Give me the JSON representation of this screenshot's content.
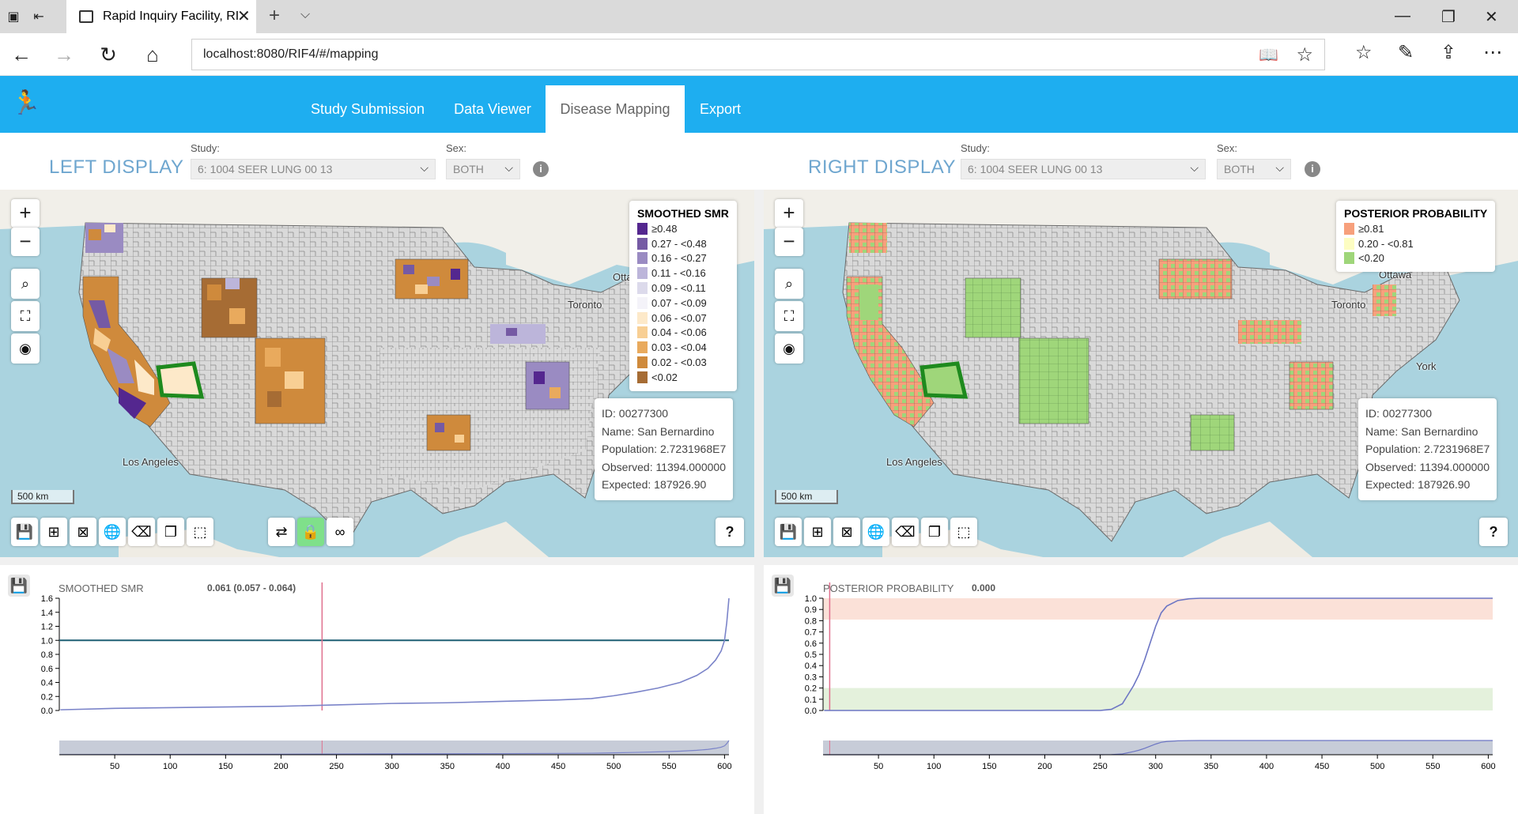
{
  "browser": {
    "tab_title": "Rapid Inquiry Facility, RI",
    "url": "localhost:8080/RIF4/#/mapping"
  },
  "app": {
    "nav": [
      "Study Submission",
      "Data Viewer",
      "Disease Mapping",
      "Export"
    ],
    "active_tab": "Disease Mapping",
    "accent_color": "#1eaef0"
  },
  "left": {
    "title": "LEFT DISPLAY",
    "study_label": "Study:",
    "study_value": "6: 1004 SEER LUNG 00 13",
    "sex_label": "Sex:",
    "sex_value": "BOTH",
    "legend": {
      "title": "SMOOTHED SMR",
      "items": [
        {
          "label": "≥0.48",
          "color": "#54278f"
        },
        {
          "label": "0.27 - <0.48",
          "color": "#755aa4"
        },
        {
          "label": "0.16 - <0.27",
          "color": "#9a8bc2"
        },
        {
          "label": "0.11 - <0.16",
          "color": "#bcb5da"
        },
        {
          "label": "0.09 - <0.11",
          "color": "#dcdaeb"
        },
        {
          "label": "0.07 - <0.09",
          "color": "#f4f3f9"
        },
        {
          "label": "0.06 - <0.07",
          "color": "#fde9c9"
        },
        {
          "label": "0.04 - <0.06",
          "color": "#f8cf94"
        },
        {
          "label": "0.03 - <0.04",
          "color": "#e9aa5d"
        },
        {
          "label": "0.02 - <0.03",
          "color": "#cf8a3c"
        },
        {
          "label": "<0.02",
          "color": "#a66c34"
        }
      ]
    },
    "info": {
      "id": "ID: 00277300",
      "name": "Name: San Bernardino",
      "population": "Population: 2.7231968E7",
      "observed": "Observed: 11394.000000",
      "expected": "Expected: 187926.90"
    },
    "scale": "500 km",
    "labels": {
      "toronto": "Toronto",
      "ottawa": "Otta",
      "losangeles": "Los Angeles"
    }
  },
  "right": {
    "title": "RIGHT DISPLAY",
    "study_label": "Study:",
    "study_value": "6: 1004 SEER LUNG 00 13",
    "sex_label": "Sex:",
    "sex_value": "BOTH",
    "legend": {
      "title": "POSTERIOR PROBABILITY",
      "items": [
        {
          "label": "≥0.81",
          "color": "#f7a07c"
        },
        {
          "label": "0.20 - <0.81",
          "color": "#fdfdc2"
        },
        {
          "label": "<0.20",
          "color": "#9fd67a"
        }
      ]
    },
    "info": {
      "id": "ID: 00277300",
      "name": "Name: San Bernardino",
      "population": "Population: 2.7231968E7",
      "observed": "Observed: 11394.000000",
      "expected": "Expected: 187926.90"
    },
    "scale": "500 km",
    "labels": {
      "toronto": "Toronto",
      "ottawa": "Ottawa",
      "york": "York",
      "losangeles": "Los Angeles"
    }
  },
  "help_label": "?",
  "chart_data": [
    {
      "type": "line",
      "title": "SMOOTHED SMR",
      "selected_value": "0.061 (0.057 - 0.064)",
      "ylim": [
        0,
        1.6
      ],
      "yticks": [
        "0.0",
        "0.2",
        "0.4",
        "0.6",
        "0.8",
        "1.0",
        "1.2",
        "1.4",
        "1.6"
      ],
      "xticks": [
        50,
        100,
        150,
        200,
        250,
        300,
        350,
        400,
        450,
        500,
        550,
        600
      ],
      "xlim": [
        0,
        604
      ],
      "reference_line": 1.0,
      "selected_rank": 237,
      "series": [
        {
          "x": [
            1,
            50,
            100,
            150,
            200,
            250,
            300,
            350,
            400,
            450,
            480,
            500,
            520,
            540,
            560,
            575,
            585,
            592,
            597,
            600,
            602,
            604
          ],
          "values": [
            0.01,
            0.03,
            0.04,
            0.05,
            0.06,
            0.08,
            0.1,
            0.11,
            0.13,
            0.15,
            0.17,
            0.21,
            0.26,
            0.32,
            0.4,
            0.5,
            0.6,
            0.72,
            0.85,
            1.0,
            1.25,
            1.6
          ]
        }
      ]
    },
    {
      "type": "line",
      "title": "POSTERIOR PROBABILITY",
      "selected_value": "0.000",
      "ylim": [
        0,
        1.0
      ],
      "yticks": [
        "0.0",
        "0.1",
        "0.2",
        "0.3",
        "0.4",
        "0.5",
        "0.6",
        "0.7",
        "0.8",
        "0.9",
        "1.0"
      ],
      "xticks": [
        50,
        100,
        150,
        200,
        250,
        300,
        350,
        400,
        450,
        500,
        550,
        600
      ],
      "xlim": [
        0,
        604
      ],
      "bands": [
        {
          "from": 0.81,
          "to": 1.0,
          "color": "#fbe1d8"
        },
        {
          "from": 0.0,
          "to": 0.2,
          "color": "#e4f1dc"
        }
      ],
      "selected_rank": 6,
      "series": [
        {
          "x": [
            1,
            50,
            100,
            150,
            200,
            250,
            260,
            270,
            275,
            280,
            285,
            290,
            295,
            300,
            305,
            310,
            320,
            330,
            340,
            604
          ],
          "values": [
            0.0,
            0.0,
            0.0,
            0.0,
            0.0,
            0.0,
            0.01,
            0.06,
            0.14,
            0.22,
            0.32,
            0.45,
            0.6,
            0.75,
            0.87,
            0.93,
            0.98,
            0.995,
            1.0,
            1.0
          ]
        }
      ]
    }
  ]
}
